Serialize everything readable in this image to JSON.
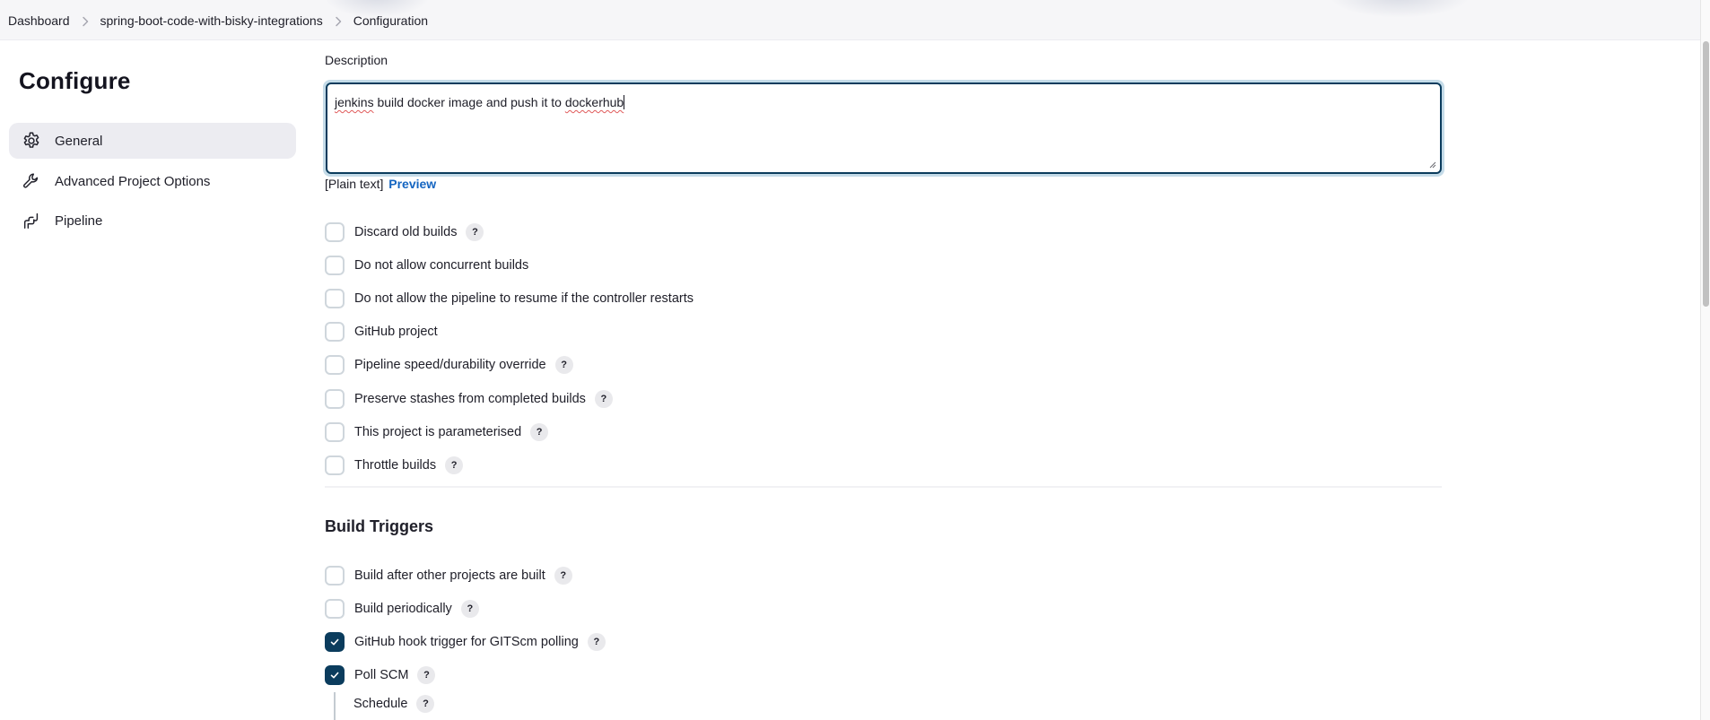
{
  "breadcrumb": [
    {
      "label": "Dashboard"
    },
    {
      "label": "spring-boot-code-with-bisky-integrations"
    },
    {
      "label": "Configuration"
    }
  ],
  "sidebar": {
    "title": "Configure",
    "items": [
      {
        "label": "General",
        "icon": "gear-icon",
        "active": true
      },
      {
        "label": "Advanced Project Options",
        "icon": "wrench-icon",
        "active": false
      },
      {
        "label": "Pipeline",
        "icon": "pipeline-icon",
        "active": false
      }
    ]
  },
  "general": {
    "description_label": "Description",
    "description_value": "jenkins build docker image and push it to dockerhub",
    "description_words": {
      "w1": "jenkins",
      "mid": " build docker image and push it to ",
      "w2": "dockerhub"
    },
    "format_label": "[Plain text]",
    "preview_label": "Preview",
    "options": [
      {
        "label": "Discard old builds",
        "checked": false,
        "help": true
      },
      {
        "label": "Do not allow concurrent builds",
        "checked": false,
        "help": false
      },
      {
        "label": "Do not allow the pipeline to resume if the controller restarts",
        "checked": false,
        "help": false
      },
      {
        "label": "GitHub project",
        "checked": false,
        "help": false
      },
      {
        "label": "Pipeline speed/durability override",
        "checked": false,
        "help": true
      },
      {
        "label": "Preserve stashes from completed builds",
        "checked": false,
        "help": true
      },
      {
        "label": "This project is parameterised",
        "checked": false,
        "help": true
      },
      {
        "label": "Throttle builds",
        "checked": false,
        "help": true
      }
    ]
  },
  "build_triggers": {
    "title": "Build Triggers",
    "options": [
      {
        "label": "Build after other projects are built",
        "checked": false,
        "help": true
      },
      {
        "label": "Build periodically",
        "checked": false,
        "help": true
      },
      {
        "label": "GitHub hook trigger for GITScm polling",
        "checked": true,
        "help": true
      },
      {
        "label": "Poll SCM",
        "checked": true,
        "help": true
      }
    ],
    "schedule_label": "Schedule"
  },
  "help_glyph": "?",
  "colors": {
    "accent": "#0b3c5d",
    "link": "#1465c1",
    "focus_ring": "#c4dbe8",
    "nav_active_bg": "#ececf1"
  }
}
